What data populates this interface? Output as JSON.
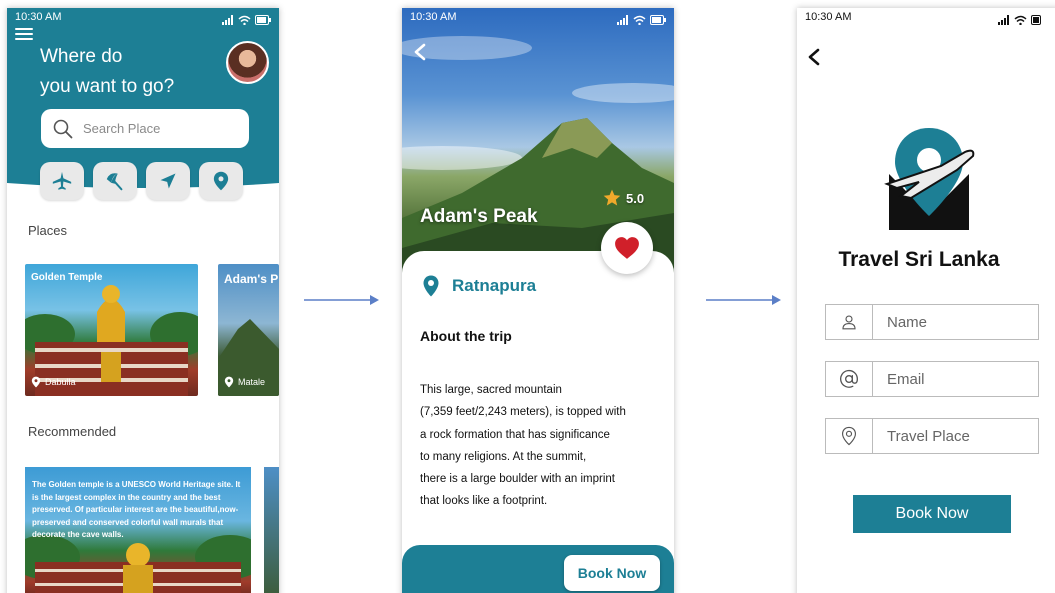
{
  "status": {
    "time": "10:30 AM"
  },
  "home": {
    "title_line1": "Where do",
    "title_line2": "you want to go?",
    "search_placeholder": "Search Place",
    "categories": [
      "plane-icon",
      "beach-umbrella-icon",
      "navigation-icon",
      "location-pin-icon"
    ],
    "places_label": "Places",
    "places": [
      {
        "title": "Golden Temple",
        "location": "Dabulla"
      },
      {
        "title": "Adam's P",
        "location": "Matale"
      }
    ],
    "recommended_label": "Recommended",
    "recommended_text": "The Golden temple is a UNESCO World Heritage site. It is the largest complex in the country and the best preserved. Of particular interest are the beautiful,now-preserved and conserved colorful wall murals that decorate the cave walls."
  },
  "detail": {
    "place_name": "Adam's Peak",
    "rating": "5.0",
    "location": "Ratnapura",
    "about_heading": "About the trip",
    "description_lines": [
      "This large, sacred mountain",
      "(7,359 feet/2,243 meters), is topped with",
      "a rock formation that has significance",
      "to many religions. At the summit,",
      "there is a large boulder with an imprint",
      "that looks like a footprint."
    ],
    "book_label": "Book Now"
  },
  "booking": {
    "brand": "Travel Sri Lanka",
    "fields": [
      {
        "placeholder": "Name",
        "icon": "user-icon"
      },
      {
        "placeholder": "Email",
        "icon": "at-icon"
      },
      {
        "placeholder": "Travel Place",
        "icon": "location-pin-icon"
      }
    ],
    "book_label": "Book Now"
  },
  "colors": {
    "primary": "#1d7f95",
    "heart": "#d0202a",
    "star": "#f0a92b"
  }
}
